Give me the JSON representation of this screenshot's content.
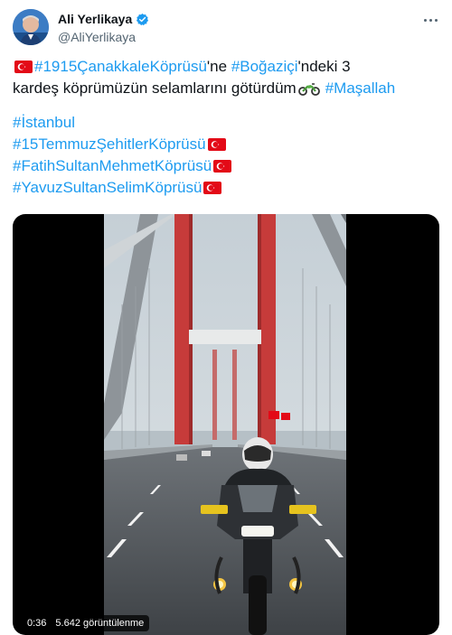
{
  "user": {
    "display_name": "Ali Yerlikaya",
    "handle": "@AliYerlikaya",
    "verified": true,
    "avatar_icon": "profile-photo"
  },
  "tweet": {
    "line1": {
      "tag_1915": "#1915ÇanakkaleKöprüsü",
      "text_ne": "'ne ",
      "tag_bogazici": "#Boğaziçi",
      "text_ndeki": "'ndeki 3"
    },
    "line2": {
      "text": "kardeş köprümüzün selamlarını götürdüm",
      "tag_masallah": "#Maşallah"
    },
    "tag_istanbul": "#İstanbul",
    "tag_15temmuz": "#15TemmuzŞehitlerKöprüsü",
    "tag_fatih": "#FatihSultanMehmetKöprüsü",
    "tag_yavuz": "#YavuzSultanSelimKöprüsü"
  },
  "video": {
    "duration": "0:36",
    "views": "5.642 görüntülenme"
  },
  "colors": {
    "link": "#1d9bf0",
    "text": "#0f1419",
    "muted": "#536471",
    "flag_red": "#e30a17",
    "verified_blue": "#1d9bf0"
  },
  "icons": [
    "turkish-flag-emoji",
    "motorcycle-emoji",
    "verified-badge-icon",
    "more-options-icon"
  ]
}
